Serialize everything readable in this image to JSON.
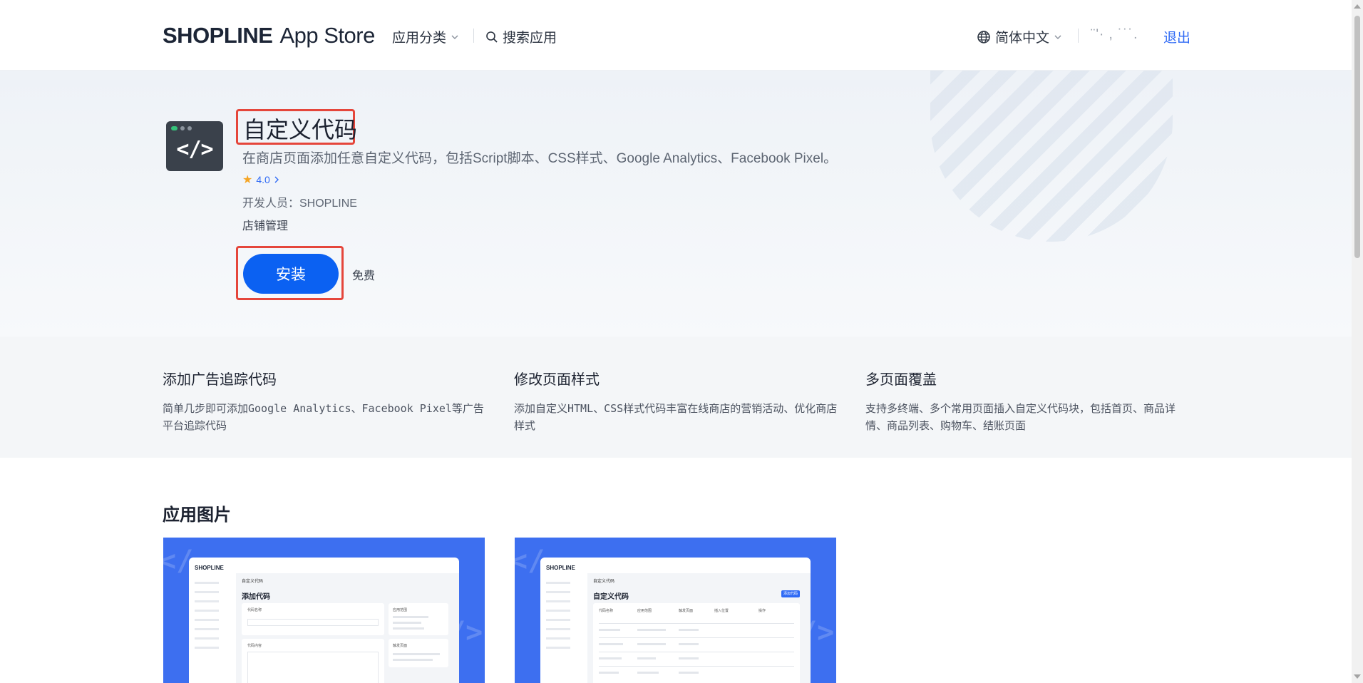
{
  "header": {
    "logo_brand": "SHOPLINE",
    "logo_suffix": "App Store",
    "nav_category": "应用分类",
    "nav_search": "搜索应用",
    "language": "简体中文",
    "user_masked": "¨'·  ,  ˙˙˙.",
    "logout": "退出"
  },
  "app": {
    "title": "自定义代码",
    "description": "在商店页面添加任意自定义代码，包括Script脚本、CSS样式、Google Analytics、Facebook Pixel。",
    "rating": "4.0",
    "developer": "开发人员：SHOPLINE",
    "category": "店铺管理",
    "install_label": "安装",
    "price": "免费",
    "icon_symbol": "</>"
  },
  "features": [
    {
      "title": "添加广告追踪代码",
      "desc": "简单几步即可添加Google Analytics、Facebook Pixel等广告平台追踪代码"
    },
    {
      "title": "修改页面样式",
      "desc": "添加自定义HTML、CSS样式代码丰富在线商店的营销活动、优化商店样式"
    },
    {
      "title": "多页面覆盖",
      "desc": "支持多终端、多个常用页面插入自定义代码块，包括首页、商品详情、商品列表、购物车、结账页面"
    }
  ],
  "screenshots": {
    "section_title": "应用图片",
    "shot1": {
      "logo": "SHOPLINE",
      "crumb": "自定义代码",
      "title": "添加代码",
      "field1": "代码名称",
      "field2": "代码内容",
      "panel1": "应用范围",
      "panel2": "触发页面"
    },
    "shot2": {
      "logo": "SHOPLINE",
      "crumb": "自定义代码",
      "title": "自定义代码",
      "button": "添加代码",
      "cols": [
        "代码名称",
        "应用范围",
        "触发页面",
        "插入位置",
        "操作"
      ]
    }
  },
  "colors": {
    "accent": "#0b61f2",
    "highlight": "#e5463b",
    "link": "#2f6af5"
  }
}
